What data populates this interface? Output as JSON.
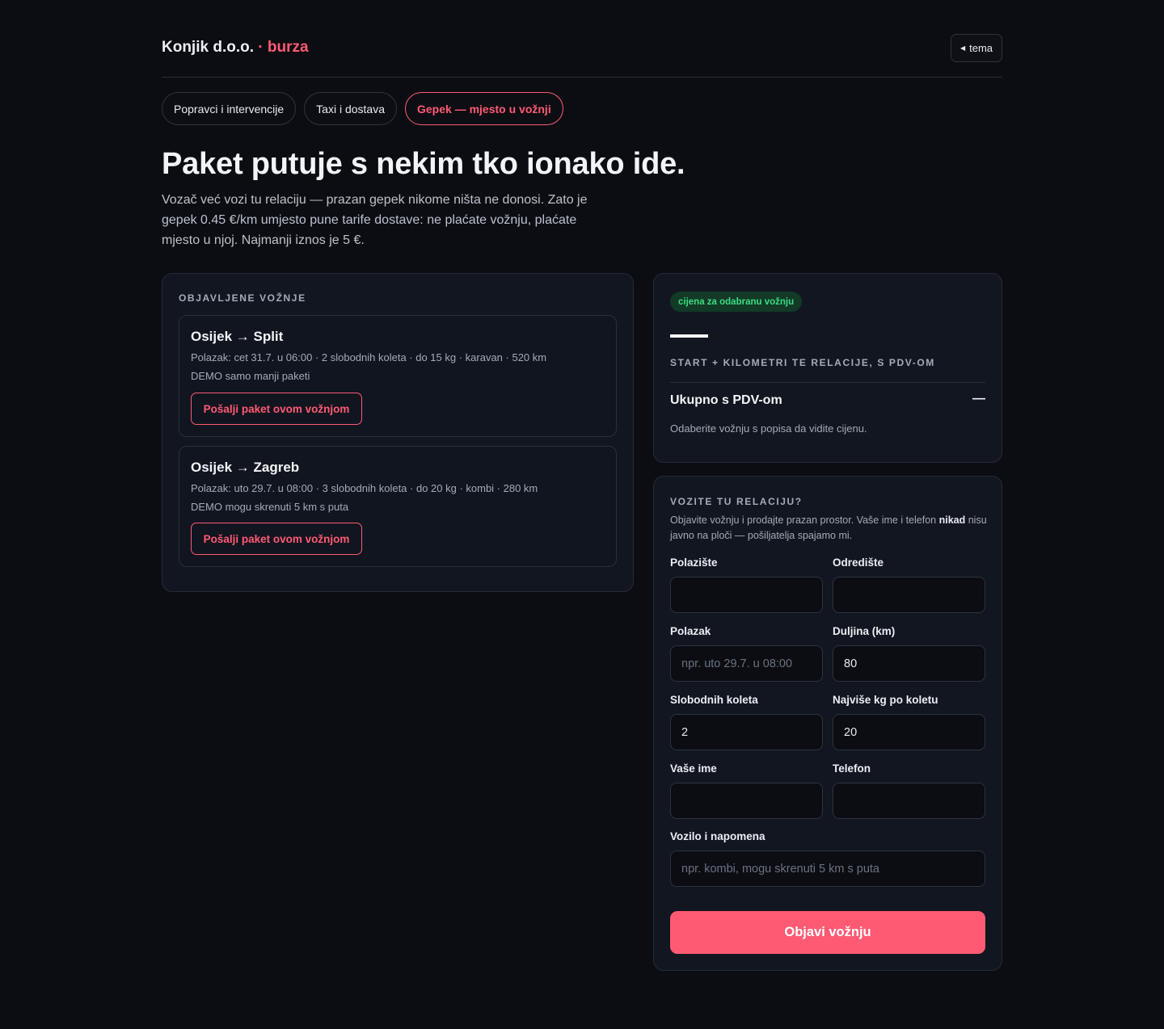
{
  "header": {
    "brand_name": "Konjik d.o.o.",
    "brand_suffix": "· burza",
    "theme_button": "tema"
  },
  "tabs": [
    {
      "label": "Popravci i intervencije",
      "active": false
    },
    {
      "label": "Taxi i dostava",
      "active": false
    },
    {
      "label": "Gepek — mjesto u vožnji",
      "active": true
    }
  ],
  "hero": {
    "title": "Paket putuje s nekim tko ionako ide.",
    "subtitle": "Vozač već vozi tu relaciju — prazan gepek nikome ništa ne donosi. Zato je gepek 0.45 €/km umjesto pune tarife dostave: ne plaćate vožnju, plaćate mjesto u njoj. Najmanji iznos je 5 €."
  },
  "rides_panel": {
    "label": "OBJAVLJENE VOŽNJE",
    "rides": [
      {
        "route": "Osijek → Split",
        "meta": "Polazak: cet 31.7. u 06:00 · 2 slobodnih koleta · do 15 kg · karavan · 520 km",
        "note": "DEMO samo manji paketi",
        "button": "Pošalji paket ovom vožnjom"
      },
      {
        "route": "Osijek → Zagreb",
        "meta": "Polazak: uto 29.7. u 08:00 · 3 slobodnih koleta · do 20 kg · kombi · 280 km",
        "note": "DEMO mogu skrenuti 5 km s puta",
        "button": "Pošalji paket ovom vožnjom"
      }
    ]
  },
  "price_panel": {
    "badge": "cijena za odabranu vožnju",
    "label": "START + KILOMETRI TE RELACIJE, S PDV-OM",
    "total_label": "Ukupno s PDV-om",
    "total_value": "—",
    "hint": "Odaberite vožnju s popisa da vidite cijenu."
  },
  "form": {
    "label": "VOZITE TU RELACIJU?",
    "desc_before": "Objavite vožnju i prodajte prazan prostor. Vaše ime i telefon ",
    "desc_bold": "nikad",
    "desc_after": " nisu javno na ploči — pošiljatelja spajamo mi.",
    "fields": {
      "origin": {
        "label": "Polazište",
        "value": ""
      },
      "destination": {
        "label": "Odredište",
        "value": ""
      },
      "departure": {
        "label": "Polazak",
        "placeholder": "npr. uto 29.7. u 08:00"
      },
      "distance": {
        "label": "Duljina (km)",
        "value": "80"
      },
      "slots": {
        "label": "Slobodnih koleta",
        "value": "2"
      },
      "max_kg": {
        "label": "Najviše kg po koletu",
        "value": "20"
      },
      "name": {
        "label": "Vaše ime",
        "value": ""
      },
      "phone": {
        "label": "Telefon",
        "value": ""
      },
      "vehicle": {
        "label": "Vozilo i napomena",
        "placeholder": "npr. kombi, mogu skrenuti 5 km s puta"
      }
    },
    "submit": "Objavi vožnju"
  },
  "colors": {
    "accent": "#ff5a73",
    "background": "#0b0d12",
    "card": "#121620",
    "badge_text": "#3ddc84"
  }
}
